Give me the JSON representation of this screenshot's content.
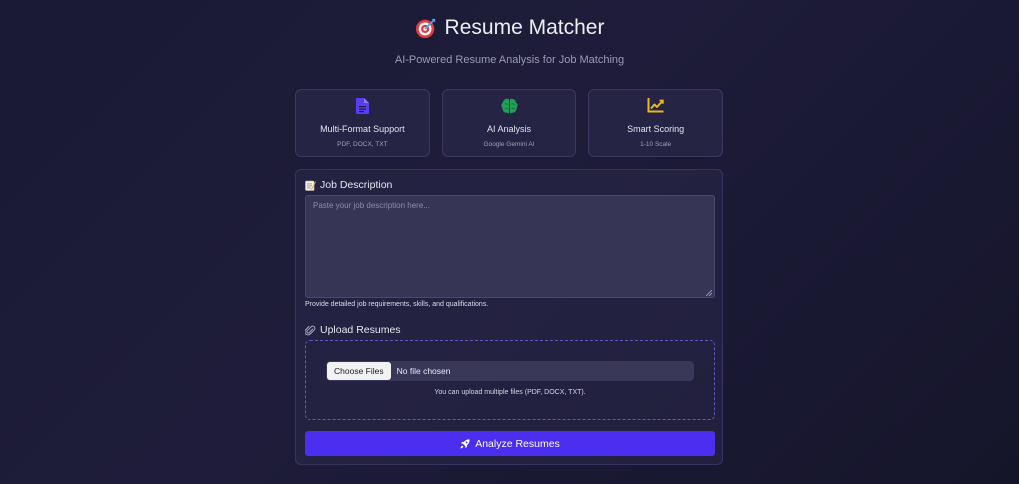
{
  "header": {
    "title": "Resume Matcher",
    "title_icon": "target-icon",
    "subtitle": "AI-Powered Resume Analysis for Job Matching"
  },
  "features": [
    {
      "icon": "document-icon",
      "icon_color": "#5b3cf5",
      "title": "Multi-Format Support",
      "subtitle": "PDF, DOCX, TXT"
    },
    {
      "icon": "brain-icon",
      "icon_color": "#1f9e5a",
      "title": "AI Analysis",
      "subtitle": "Google Gemini AI"
    },
    {
      "icon": "chart-line-icon",
      "icon_color": "#e8b820",
      "title": "Smart Scoring",
      "subtitle": "1-10 Scale"
    }
  ],
  "form": {
    "job_description": {
      "label": "Job Description",
      "icon": "memo-icon",
      "value": "",
      "placeholder": "Paste your job description here...",
      "hint": "Provide detailed job requirements, skills, and qualifications."
    },
    "upload": {
      "label": "Upload Resumes",
      "icon": "paperclip-icon",
      "choose_label": "Choose Files",
      "status": "No file chosen",
      "note": "You can upload multiple files (PDF, DOCX, TXT)."
    },
    "submit": {
      "label": "Analyze Resumes",
      "icon": "rocket-icon"
    }
  },
  "colors": {
    "accent": "#4c2ef0",
    "dropzone_border": "#5b59c6",
    "background": "#1c1b36"
  }
}
